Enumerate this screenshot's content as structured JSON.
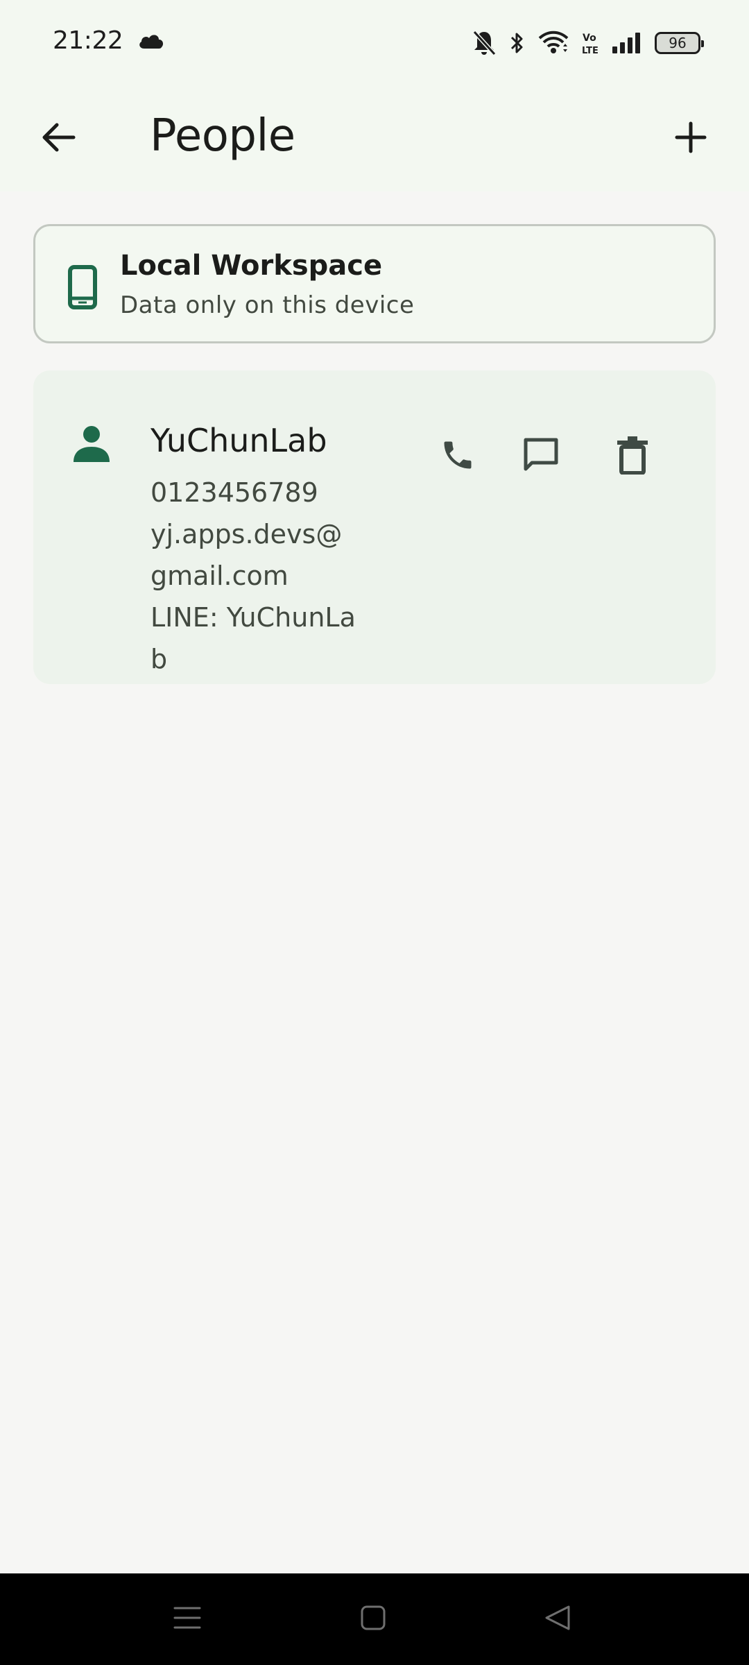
{
  "status_bar": {
    "time": "21:22",
    "battery_level": "96",
    "icons": [
      "cloud-icon",
      "bell-off-icon",
      "bluetooth-icon",
      "wifi-icon",
      "volte-icon",
      "signal-icon",
      "battery-icon"
    ]
  },
  "app_bar": {
    "title": "People",
    "back_icon": "arrow-left-icon",
    "add_icon": "plus-icon"
  },
  "workspace": {
    "title": "Local Workspace",
    "subtitle": "Data only on this device",
    "icon": "phone-device-icon"
  },
  "contacts": [
    {
      "name": "YuChunLab",
      "phone": "0123456789",
      "email": "yj.apps.devs@gmail.com",
      "line": "LINE: YuChunLab",
      "actions": [
        "phone-icon",
        "message-icon",
        "trash-icon"
      ]
    }
  ],
  "nav_bar": {
    "icons": [
      "menu-icon",
      "home-icon",
      "back-triangle-icon"
    ]
  },
  "colors": {
    "accent": "#1e6a4b",
    "surface": "#f3f8f1",
    "card": "#edf3ec",
    "background": "#f6f6f4"
  }
}
